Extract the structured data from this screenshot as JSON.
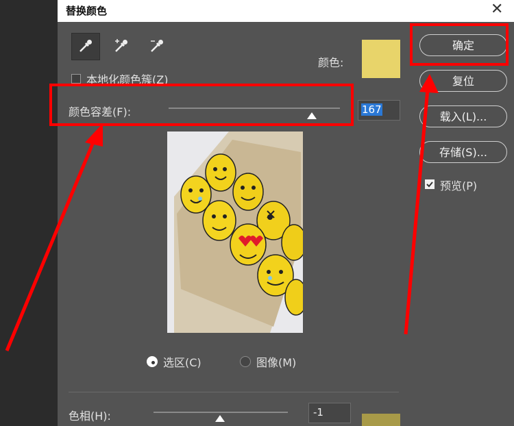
{
  "window": {
    "title": "替换颜色",
    "close_glyph": "✕"
  },
  "eyedroppers": [
    {
      "icon": "eyedropper-icon",
      "active": true
    },
    {
      "icon": "eyedropper-plus-icon",
      "active": false
    },
    {
      "icon": "eyedropper-minus-icon",
      "active": false
    }
  ],
  "color": {
    "label": "颜色:",
    "swatch": "#e8d46a"
  },
  "localized": {
    "label": "本地化颜色簇(Z)",
    "checked": false
  },
  "fuzziness": {
    "label": "颜色容差(F):",
    "value": "167",
    "min": 0,
    "max": 200
  },
  "selection_mode": {
    "selection_label": "选区(C)",
    "image_label": "图像(M)",
    "selected": "selection"
  },
  "hue": {
    "label": "色相(H):",
    "value": "-1",
    "min": -180,
    "max": 180,
    "swatch": "#a89a48"
  },
  "buttons": {
    "ok": "确定",
    "reset": "复位",
    "load": "载入(L)...",
    "save": "存储(S)..."
  },
  "preview": {
    "label": "预览(P)",
    "checked": true
  },
  "colors": {
    "highlight": "#ff0000",
    "field_selected": "#2a78d6"
  }
}
